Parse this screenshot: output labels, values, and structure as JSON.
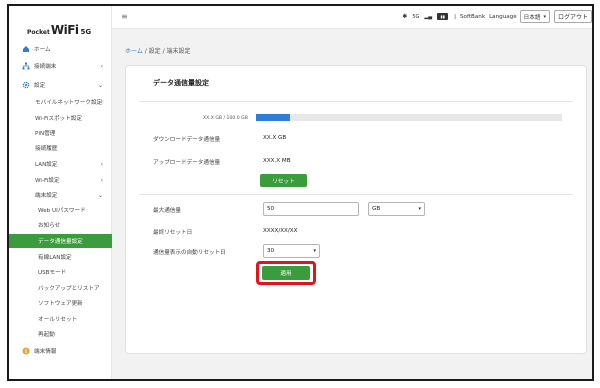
{
  "brand": {
    "pocket": "Pocket",
    "wifi": "WiFi",
    "model": "5G"
  },
  "sidebar": {
    "home": "ホーム",
    "connected": "接続端末",
    "settings": "設定",
    "mobile_network": "モバイルネットワーク設定",
    "wifi_spot": "Wi-Fiスポット設定",
    "pin": "PIN管理",
    "conn_history": "接続履歴",
    "lan": "LAN設定",
    "wifi": "Wi-Fi設定",
    "device": "端末設定",
    "web_ui_password": "Web UIパスワード",
    "notice": "お知らせ",
    "data_usage": "データ通信量設定",
    "wired_lan": "有線LAN設定",
    "usb_mode": "USBモード",
    "backup": "バックアップとリストア",
    "software_update": "ソフトウェア更新",
    "all_reset": "オールリセット",
    "reboot": "再起動",
    "device_info": "端末情報"
  },
  "topbar": {
    "signal": "5G",
    "carrier": "SoftBank",
    "language_label": "Language",
    "language_value": "日本語",
    "logout": "ログアウト"
  },
  "breadcrumb": {
    "home": "ホーム",
    "sep1": " / ",
    "settings": "設定",
    "sep2": " / ",
    "device": "端末設定"
  },
  "card": {
    "title": "データ通信量設定",
    "usage_text": "XX.X GB / 100.0 GB",
    "usage_fraction": 0.11,
    "download_label": "ダウンロードデータ通信量",
    "download_value": "XX.X GB",
    "upload_label": "アップロードデータ通信量",
    "upload_value": "XXX.X MB",
    "reset_button": "リセット",
    "max_label": "最大通信量",
    "max_value": "50",
    "unit_value": "GB",
    "last_reset_label": "最終リセット日",
    "last_reset_value": "XXXX/XX/XX",
    "auto_reset_label": "通信量表示の自動リセット日",
    "auto_reset_value": "30",
    "apply_button": "適用"
  },
  "colors": {
    "accent_green": "#3a9c3d",
    "accent_blue": "#2e7dd6",
    "highlight_red": "#e0161c"
  }
}
